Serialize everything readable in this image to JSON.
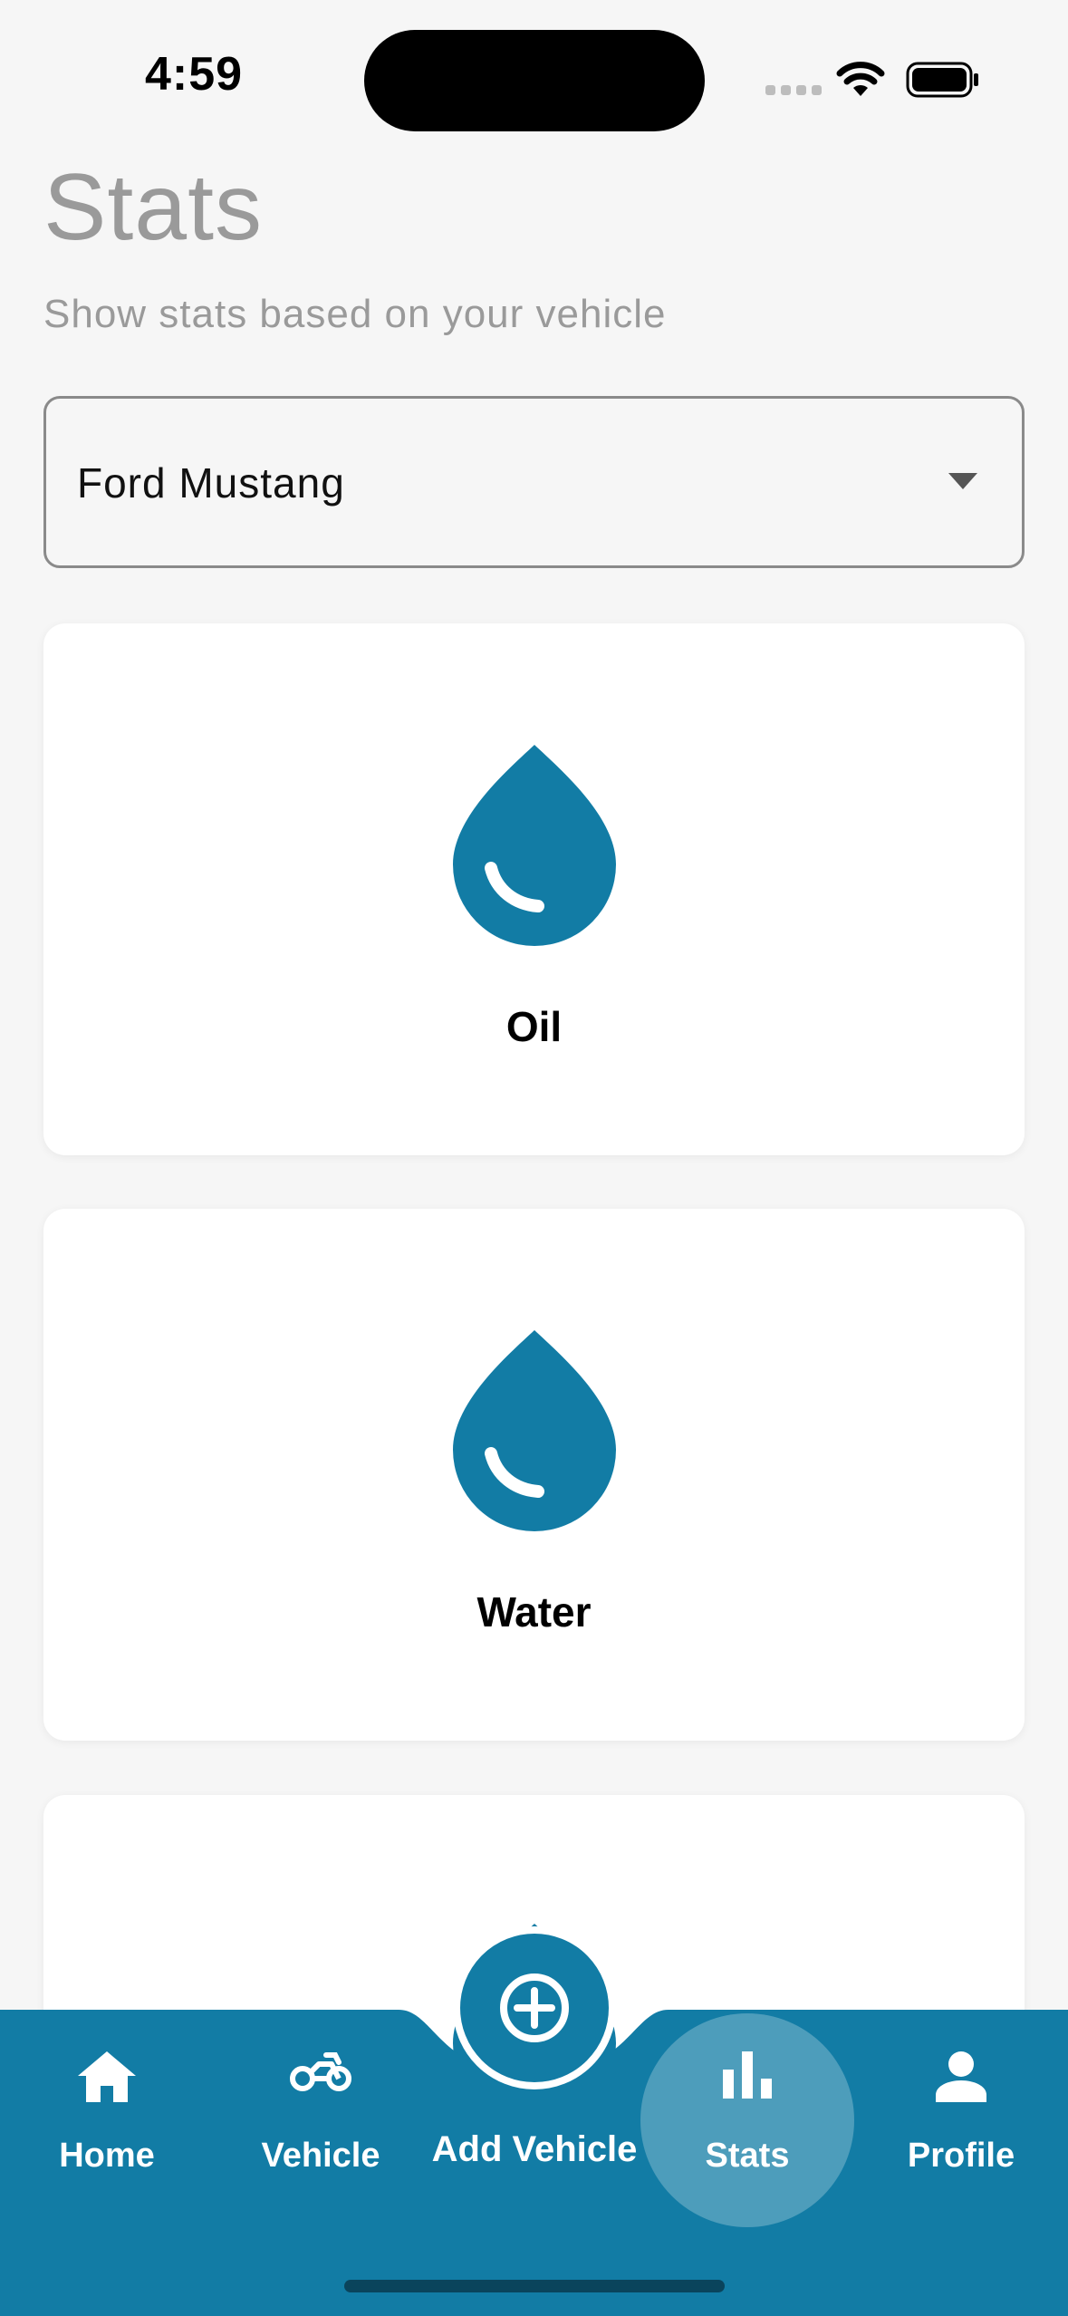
{
  "status_bar": {
    "time": "4:59",
    "icons": [
      "cellular-signal-icon",
      "wifi-icon",
      "battery-icon"
    ]
  },
  "header": {
    "title": "Stats",
    "subtitle": "Show stats based on your vehicle"
  },
  "vehicle_select": {
    "selected": "Ford Mustang",
    "icon": "dropdown-caret-icon"
  },
  "stat_cards": [
    {
      "label": "Oil",
      "icon": "drop-icon"
    },
    {
      "label": "Water",
      "icon": "drop-icon"
    },
    {
      "label": "",
      "icon": "drop-icon"
    }
  ],
  "bottom_nav": {
    "items": [
      {
        "label": "Home",
        "icon": "home-icon"
      },
      {
        "label": "Vehicle",
        "icon": "motorcycle-icon"
      },
      {
        "label": "Add Vehicle",
        "icon": "add-circle-icon"
      },
      {
        "label": "Stats",
        "icon": "bar-chart-icon",
        "active": true
      },
      {
        "label": "Profile",
        "icon": "person-icon"
      }
    ]
  },
  "colors": {
    "accent": "#127ca5",
    "background": "#f6f6f6",
    "card": "#ffffff",
    "muted_text": "#9a9a9a"
  }
}
